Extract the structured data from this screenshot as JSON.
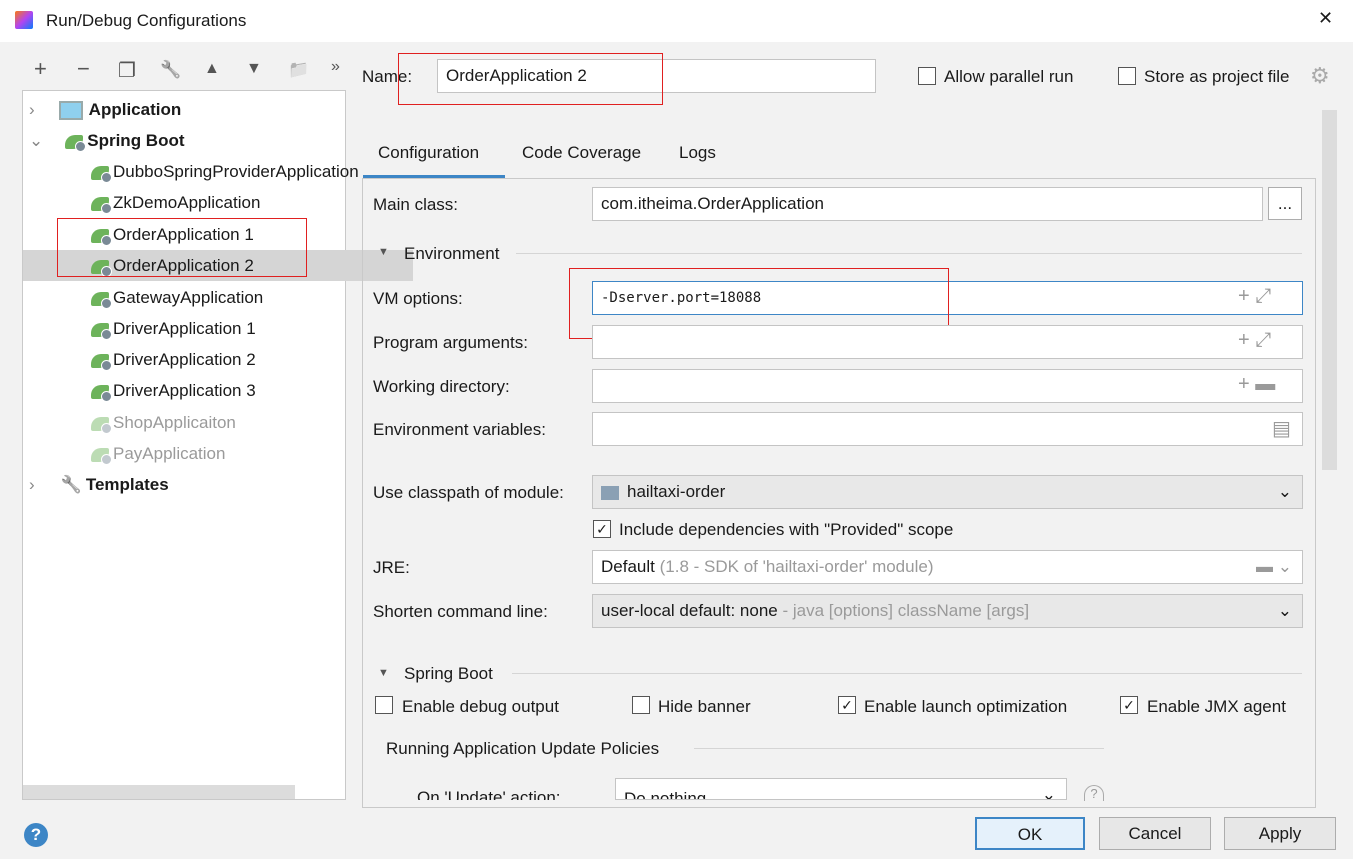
{
  "window": {
    "title": "Run/Debug Configurations",
    "close": "✕"
  },
  "toolbar": {
    "add": "+",
    "remove": "−",
    "copy": "❐",
    "edit": "🔧",
    "up": "▲",
    "down": "▼",
    "folder": "📁",
    "more": "»"
  },
  "tree": {
    "groups": [
      {
        "label": "Application",
        "expanded": false
      },
      {
        "label": "Spring Boot",
        "expanded": true
      },
      {
        "label": "Templates",
        "expanded": false
      }
    ],
    "items": [
      {
        "label": "DubboSpringProviderApplication",
        "enabled": true
      },
      {
        "label": "ZkDemoApplication",
        "enabled": true
      },
      {
        "label": "OrderApplication 1",
        "enabled": true
      },
      {
        "label": "OrderApplication 2",
        "enabled": true,
        "selected": true
      },
      {
        "label": "GatewayApplication",
        "enabled": true
      },
      {
        "label": "DriverApplication 1",
        "enabled": true
      },
      {
        "label": "DriverApplication 2",
        "enabled": true
      },
      {
        "label": "DriverApplication 3",
        "enabled": true
      },
      {
        "label": "ShopApplicaiton",
        "enabled": false
      },
      {
        "label": "PayApplication",
        "enabled": false
      }
    ]
  },
  "name": {
    "label": "Name:",
    "value": "OrderApplication 2"
  },
  "allow_parallel": {
    "label": "Allow parallel run",
    "checked": false
  },
  "store_project": {
    "label": "Store as project file",
    "checked": false
  },
  "tabs": [
    {
      "label": "Configuration",
      "active": true
    },
    {
      "label": "Code Coverage"
    },
    {
      "label": "Logs"
    }
  ],
  "config": {
    "main_class": {
      "label": "Main class:",
      "value": "com.itheima.OrderApplication",
      "browse": "..."
    },
    "environment": {
      "title": "Environment"
    },
    "vm_options": {
      "label": "VM options:",
      "value": "-Dserver.port=18088"
    },
    "program_args": {
      "label": "Program arguments:",
      "value": ""
    },
    "working_dir": {
      "label": "Working directory:",
      "value": ""
    },
    "env_vars": {
      "label": "Environment variables:",
      "value": ""
    },
    "classpath": {
      "label": "Use classpath of module:",
      "value": "hailtaxi-order"
    },
    "include_deps": {
      "label": "Include dependencies with \"Provided\" scope",
      "checked": true
    },
    "jre": {
      "label": "JRE:",
      "value": "Default",
      "hint": "(1.8 - SDK of 'hailtaxi-order' module)"
    },
    "shorten": {
      "label": "Shorten command line:",
      "value": "user-local default: none",
      "hint": " - java [options] className [args]"
    },
    "spring_boot": {
      "title": "Spring Boot",
      "debug_output": {
        "label": "Enable debug output",
        "checked": false
      },
      "hide_banner": {
        "label": "Hide banner",
        "checked": false
      },
      "launch_opt": {
        "label": "Enable launch optimization",
        "checked": true
      },
      "jmx": {
        "label": "Enable JMX agent",
        "checked": true
      }
    },
    "update_policies": {
      "title": "Running Application Update Policies",
      "on_update_label": "On 'Update' action:",
      "on_update_value": "Do nothing"
    }
  },
  "buttons": {
    "ok": "OK",
    "cancel": "Cancel",
    "apply": "Apply",
    "help": "?"
  },
  "colors": {
    "accent": "#3d86c6",
    "highlight": "#e02020"
  }
}
